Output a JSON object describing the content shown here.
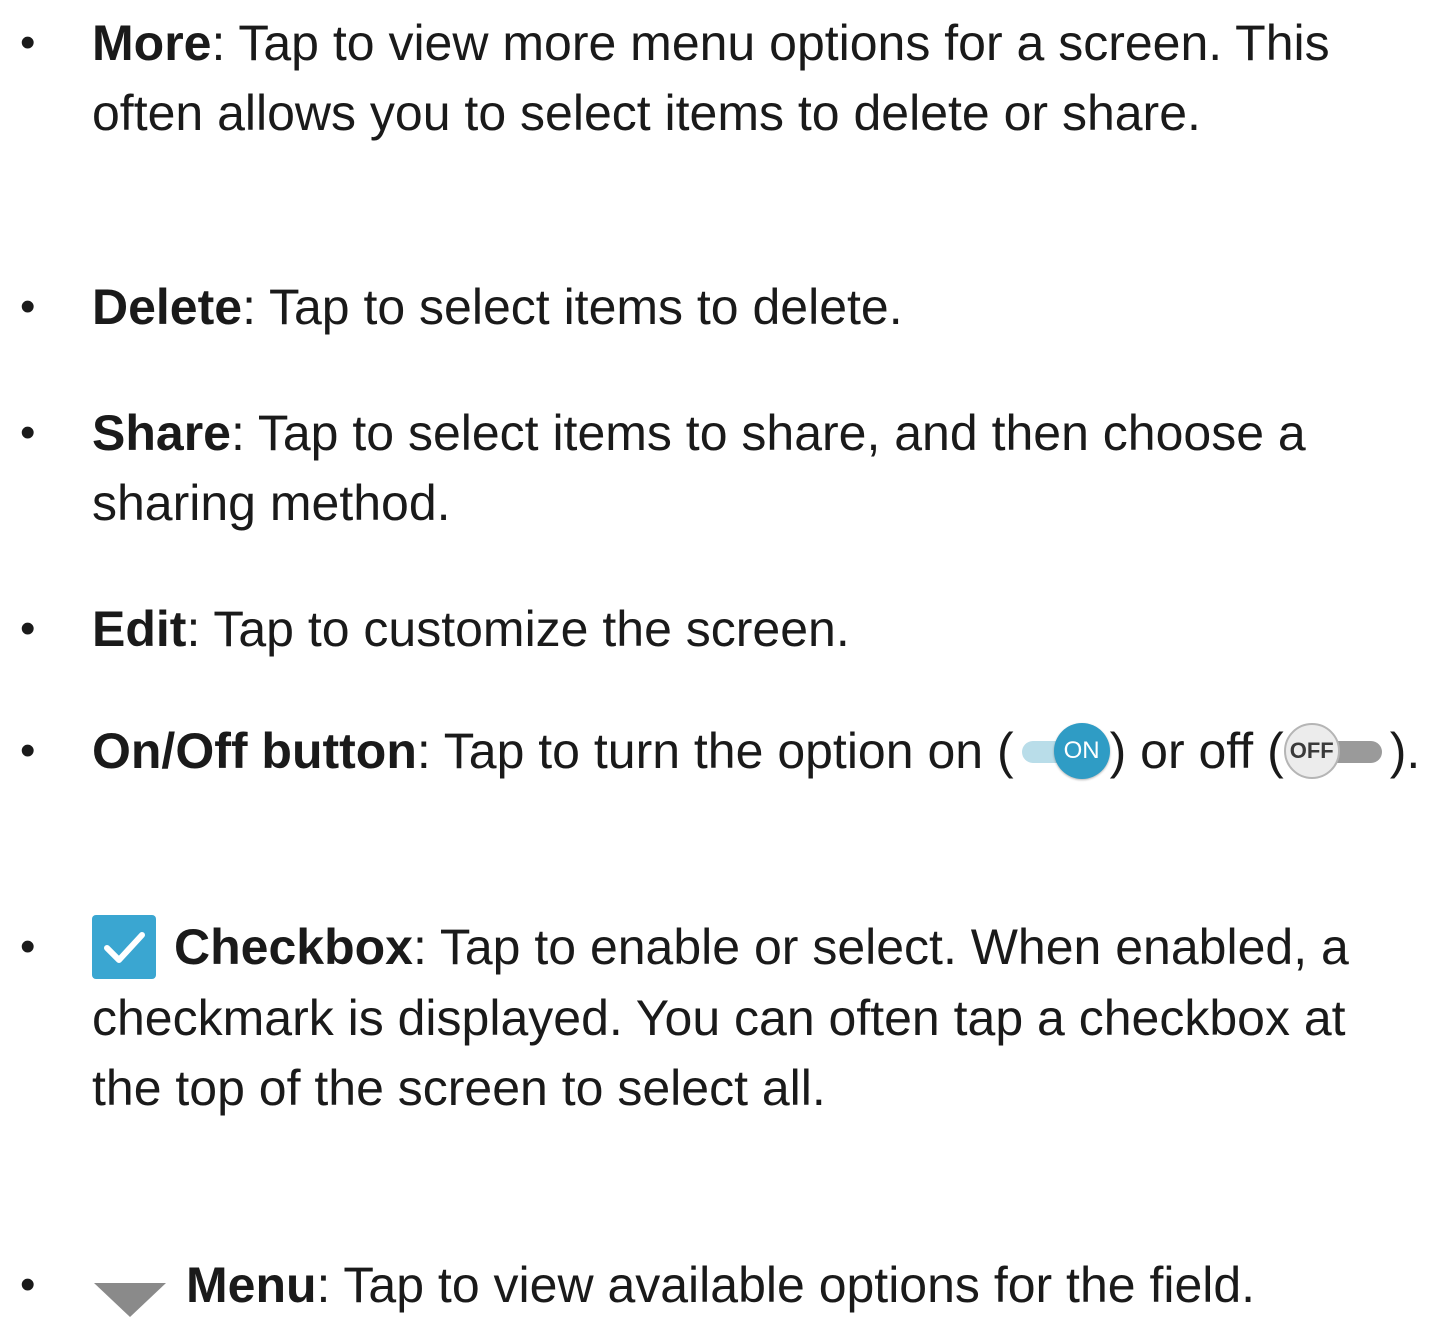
{
  "items": [
    {
      "term": "More",
      "text": ": Tap to view more menu options for a screen. This often allows you to select items to delete or share."
    },
    {
      "term": "Delete",
      "text": ": Tap to select items to delete."
    },
    {
      "term": "Share",
      "text": ": Tap to select items to share, and then choose a sharing method."
    },
    {
      "term": "Edit",
      "text": ": Tap to customize the screen."
    },
    {
      "term": "On/Off button",
      "text_before_on": ": Tap to turn the option on (",
      "on_label": "ON",
      "text_between": ") or off (",
      "off_label": "OFF",
      "text_after_off": ")."
    },
    {
      "term": "Checkbox",
      "text": ": Tap to enable or select. When enabled, a checkmark is displayed. You can often tap a checkbox at the top of the screen to select all."
    },
    {
      "term": "Menu",
      "text": ": Tap to view available options for the field."
    }
  ],
  "bullet": "•",
  "icons": {
    "checkbox": "checkbox-checked-icon",
    "menu": "dropdown-triangle-icon",
    "toggle_on": "toggle-on-icon",
    "toggle_off": "toggle-off-icon"
  },
  "colors": {
    "text": "#1a1a1a",
    "accent_blue": "#2f9cc5",
    "checkbox_blue": "#3aa6d1",
    "menu_gray": "#8a8a8a"
  }
}
